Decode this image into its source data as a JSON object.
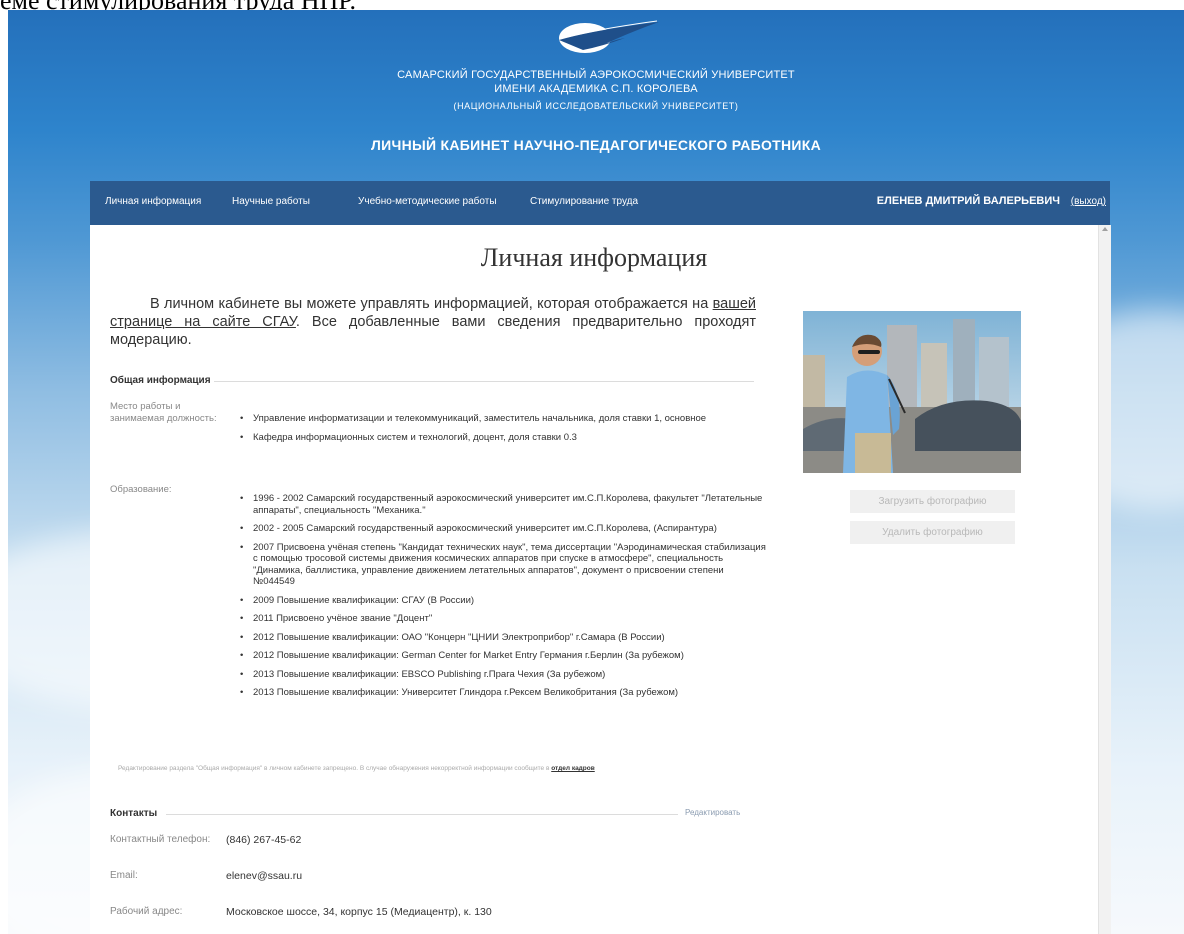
{
  "doc_caption": "еме стимулирования труда НПР.",
  "header": {
    "univ_line1": "САМАРСКИЙ ГОСУДАРСТВЕННЫЙ АЭРОКОСМИЧЕСКИЙ УНИВЕРСИТЕТ",
    "univ_line2": "ИМЕНИ АКАДЕМИКА С.П. КОРОЛЕВА",
    "univ_line3": "(НАЦИОНАЛЬНЫЙ ИССЛЕДОВАТЕЛЬСКИЙ УНИВЕРСИТЕТ)",
    "cabinet_title": "ЛИЧНЫЙ КАБИНЕТ НАУЧНО-ПЕДАГОГИЧЕСКОГО РАБОТНИКА"
  },
  "nav": {
    "items": [
      "Личная информация",
      "Научные работы",
      "Учебно-методические работы",
      "Стимулирование труда"
    ],
    "user_name": "ЕЛЕНЕВ ДМИТРИЙ ВАЛЕРЬЕВИЧ",
    "logout": "(выход)"
  },
  "page": {
    "title": "Личная информация",
    "intro_before": "В личном кабинете вы можете управлять информацией, которая отображается на ",
    "intro_link": "вашей странице на сайте СГАУ",
    "intro_after": ". Все добавленные вами сведения предварительно проходят модерацию."
  },
  "general": {
    "heading": "Общая информация",
    "work_label": "Место работы и занимаемая должность:",
    "work_items": [
      "Управление информатизации и телекоммуникаций, заместитель начальника, доля ставки 1, основное",
      "Кафедра информационных систем и технологий, доцент, доля ставки 0.3"
    ],
    "edu_label": "Образование:",
    "edu_items": [
      "1996 - 2002 Самарский государственный аэрокосмический университет им.С.П.Королева, факультет \"Летательные аппараты\", специальность \"Механика.\"",
      "2002 - 2005 Самарский государственный аэрокосмический университет им.С.П.Королева, (Аспирантура)",
      "2007 Присвоена учёная степень \"Кандидат технических наук\", тема диссертации \"Аэродинамическая стабилизация с помощью тросовой системы движения космических аппаратов при спуске в атмосфере\", специальность \"Динамика, баллистика, управление движением летательных аппаратов\", документ о присвоении степени №044549",
      "2009 Повышение квалификации: СГАУ (В России)",
      "2011 Присвоено учёное звание \"Доцент\"",
      "2012 Повышение квалификации: ОАО \"Концерн \"ЦНИИ Электроприбор\" г.Самара (В России)",
      "2012 Повышение квалификации: German Center for Market Entry Германия г.Берлин (За рубежом)",
      "2013 Повышение квалификации: EBSCO Publishing г.Прага Чехия (За рубежом)",
      "2013 Повышение квалификации: Университет Глиндора г.Рексем Великобритания (За рубежом)"
    ],
    "notice_text": "Редактирование раздела \"Общая информация\" в личном кабинете запрещено. В случае обнаружения некорректной информации сообщите в ",
    "notice_link": "отдел кадров"
  },
  "contacts": {
    "heading": "Контакты",
    "edit": "Редактировать",
    "phone_label": "Контактный телефон:",
    "phone": "(846) 267-45-62",
    "email_label": "Email:",
    "email": "elenev@ssau.ru",
    "address_label": "Рабочий адрес:",
    "address": "Московское шоссе, 34, корпус 15 (Медиацентр), к. 130"
  },
  "photo_panel": {
    "upload": "Загрузить фотографию",
    "delete": "Удалить фотографию"
  },
  "colors": {
    "header_blue": "#2470bb",
    "navbar": "#2b5a8f"
  }
}
